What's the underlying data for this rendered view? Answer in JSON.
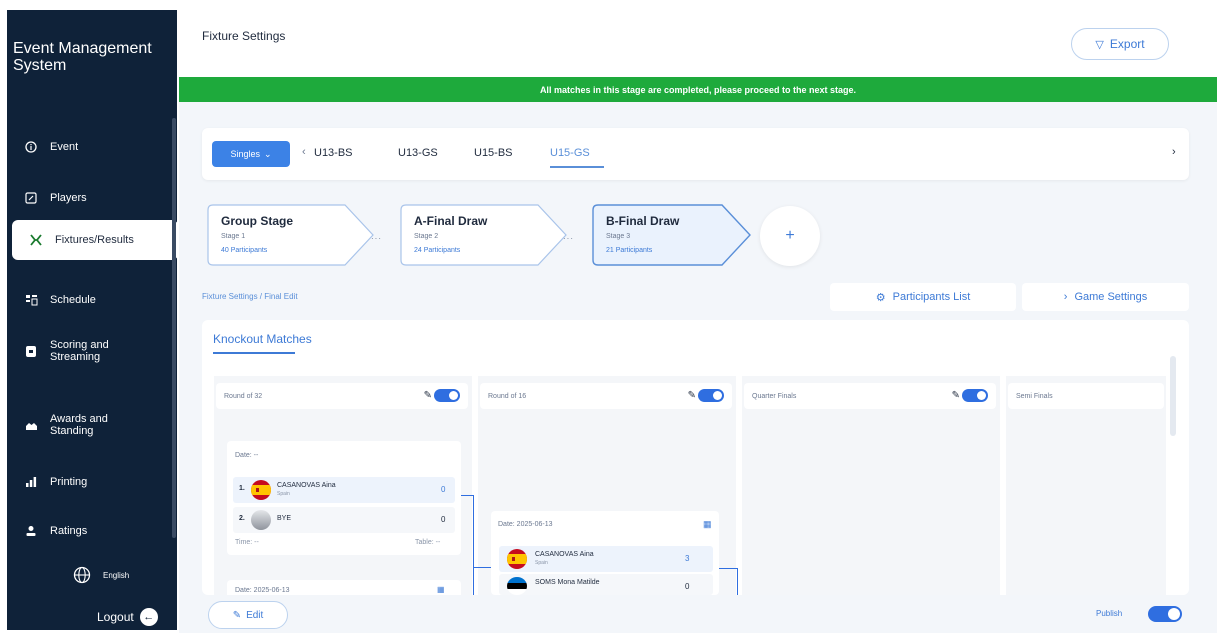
{
  "app": {
    "name": "Event Management System"
  },
  "sidebar": {
    "items": [
      {
        "label": "Event",
        "icon": "info-circle-icon"
      },
      {
        "label": "Players",
        "icon": "edit-square-icon"
      },
      {
        "label": "Fixtures/Results",
        "icon": "fixtures-icon"
      },
      {
        "label": "Schedule",
        "icon": "schedule-icon"
      },
      {
        "label": "Scoring and Streaming",
        "icon": "scoring-icon"
      },
      {
        "label": "Awards and Standing",
        "icon": "awards-icon"
      },
      {
        "label": "Printing",
        "icon": "bar-chart-icon"
      },
      {
        "label": "Ratings",
        "icon": "person-icon"
      }
    ],
    "active_item": "Fixtures/Results",
    "language": "English",
    "logout": "Logout"
  },
  "header": {
    "title": "Fixture Settings",
    "export_label": "Export"
  },
  "banner": {
    "message": "All matches in this stage are completed, please proceed to the next stage.",
    "color": "#1eaa3c"
  },
  "category_tabs": {
    "type_select": "Singles",
    "tabs": [
      "U13-BS",
      "U13-GS",
      "U15-BS",
      "U15-GS"
    ],
    "active_tab": "U15-GS"
  },
  "stages": [
    {
      "name": "Group Stage",
      "sub": "Stage 1",
      "count": "40 Participants"
    },
    {
      "name": "A-Final Draw",
      "sub": "Stage 2",
      "count": "24 Participants"
    },
    {
      "name": "B-Final Draw",
      "sub": "Stage 3",
      "count": "21 Participants"
    }
  ],
  "breadcrumb": "Fixture Settings / Final Edit",
  "actions": {
    "participants_list": "Participants List",
    "game_settings": "Game Settings"
  },
  "knockout": {
    "title": "Knockout Matches",
    "rounds": [
      "Round of 32",
      "Round of 16",
      "Quarter Finals",
      "Semi Finals"
    ],
    "matches": [
      {
        "date": "Date: --",
        "p1": {
          "seed": "1.",
          "name": "CASANOVAS Aina",
          "country": "Spain",
          "score": "0"
        },
        "p2": {
          "seed": "2.",
          "name": "BYE",
          "country": "",
          "score": "0"
        },
        "time": "Time: --",
        "table": "Table: --"
      },
      {
        "date": "Date: 2025-06-13",
        "icon": "calendar-icon",
        "p1": {
          "name": "CASANOVAS Aina",
          "country": "Spain",
          "score": "3"
        },
        "p2": {
          "name": "SOMS Mona Matilde",
          "country": "",
          "score": "0"
        }
      },
      {
        "date": "Date: 2025-06-13"
      }
    ]
  },
  "footer": {
    "edit_label": "Edit",
    "publish_label": "Publish",
    "publish_on": true
  },
  "colors": {
    "sidebar_bg": "#0f2239",
    "accent": "#3c82e6",
    "success": "#1eaa3c"
  }
}
